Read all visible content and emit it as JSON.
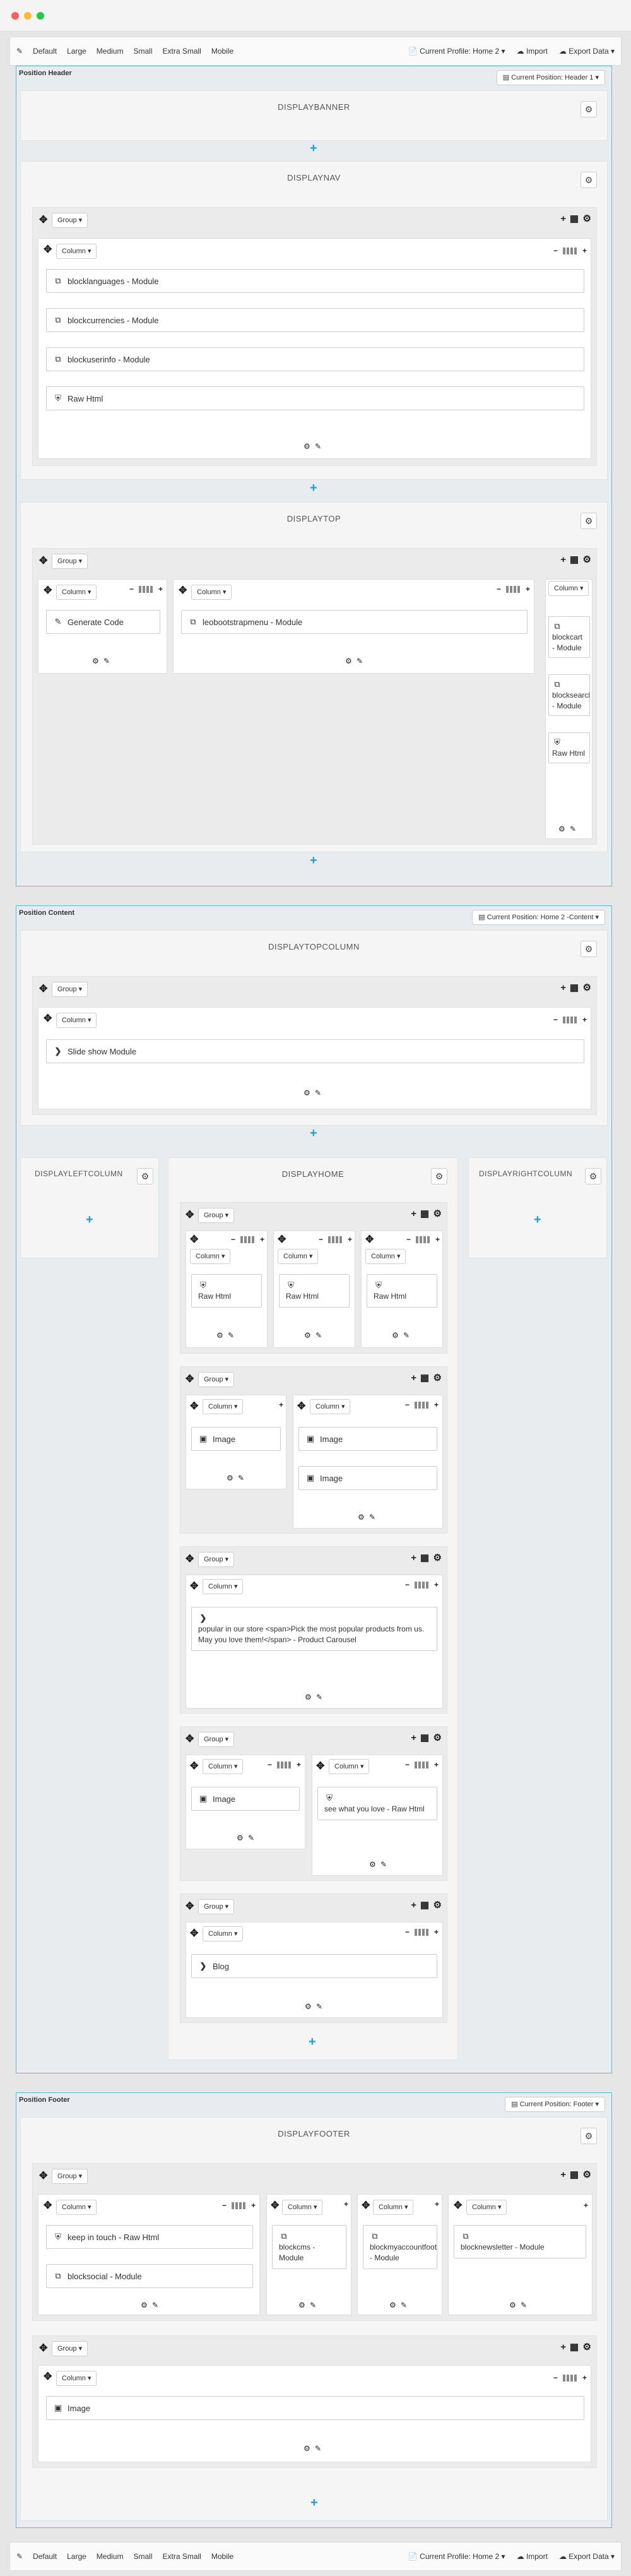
{
  "toolbar": {
    "edit_icon": "pencil-icon",
    "profiles": [
      "Default",
      "Large",
      "Medium",
      "Small",
      "Extra Small",
      "Mobile"
    ],
    "current_profile": "Current Profile: Home 2",
    "import_label": "Import",
    "export_label": "Export Data"
  },
  "header": {
    "title": "Position Header",
    "current_position": "Current Position: Header 1",
    "displaybanner": "DISPLAYBANNER",
    "displaynav": "DISPLAYNAV",
    "displaytop": "DISPLAYTOP",
    "nav_modules": [
      "blocklanguages - Module",
      "blockcurrencies - Module",
      "blockuserinfo - Module",
      "Raw Html"
    ],
    "top_generate": "Generate Code",
    "top_leo": "leobootstrapmenu - Module",
    "top_side": [
      "blockcart - Module",
      "blocksearch - Module",
      "Raw Html"
    ]
  },
  "content": {
    "title": "Position Content",
    "current_position": "Current Position: Home 2 -Content",
    "displaytopcolumn": "DISPLAYTOPCOLUMN",
    "slideshow": "Slide show Module",
    "displayleftcolumn": "DISPLAYLEFTCOLUMN",
    "displayhome": "DISPLAYHOME",
    "displayrightcolumn": "DISPLAYRIGHTCOLUMN",
    "raw_html": "Raw Html",
    "image": "Image",
    "carousel": "popular in our store <span>Pick the most popular products from us. May you love them!</span> - Product Carousel",
    "see_what": "see what you love - Raw Html",
    "blog": "Blog"
  },
  "footer": {
    "title": "Position Footer",
    "current_position": "Current Position: Footer",
    "displayfooter": "DISPLAYFOOTER",
    "keep_in_touch": "keep in touch - Raw Html",
    "blocksocial": "blocksocial - Module",
    "blockcms": "blockcms - Module",
    "blockmyaccount": "blockmyaccountfooter - Module",
    "blocknewsletter": "blocknewsletter - Module",
    "image": "Image"
  },
  "labels": {
    "group": "Group",
    "column": "Column"
  }
}
